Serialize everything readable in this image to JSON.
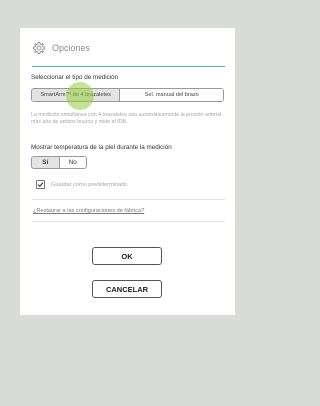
{
  "dialog": {
    "title": "Opciones",
    "title_icon": "gear-icon",
    "measurement_mode_label": "Seleccionar el tipo de medición",
    "mode_options": [
      {
        "label": "SmartArm™ de 4 brazaletes",
        "selected": true
      },
      {
        "label": "Sel. manual del brazo",
        "selected": false
      }
    ],
    "mode_description": "La medición simultánea con 4 brazaletes usa automáticamente la presión arterial más alta de ambos brazos y mide el IDB.",
    "skin_temp_label": "Mostrar temperatura de la piel durante la medición",
    "skin_temp_options": [
      {
        "label": "Sí",
        "selected": true
      },
      {
        "label": "No",
        "selected": false
      }
    ],
    "save_default_label": "Guardar como predeterminado",
    "save_default_checked": true,
    "restore_link": "¿Restaurar a las configuraciones de fábrica?",
    "ok_label": "OK",
    "cancel_label": "CANCELAR"
  },
  "colors": {
    "accent": "#4fb3a4",
    "touch_indicator": "#96cd3c",
    "background": "#d9dcd6"
  }
}
